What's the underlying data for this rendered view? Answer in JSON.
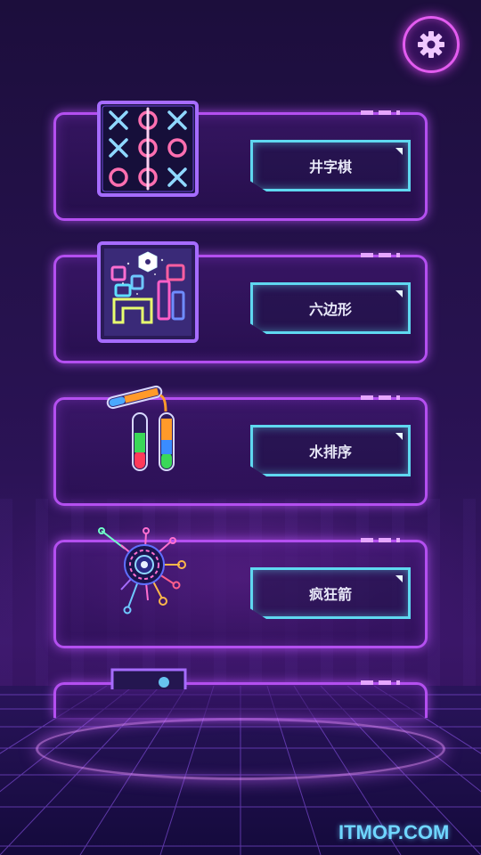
{
  "menu": {
    "games": [
      {
        "label": "井字棋",
        "icon": "tic-tac-toe-icon"
      },
      {
        "label": "六边形",
        "icon": "hexa-blocks-icon"
      },
      {
        "label": "水排序",
        "icon": "water-sort-tubes-icon"
      },
      {
        "label": "疯狂箭",
        "icon": "crazy-arrow-target-icon"
      }
    ]
  },
  "settings": {
    "icon": "gear-icon"
  },
  "watermark": "ITMOP.COM",
  "colors": {
    "card_border": "#b44ff0",
    "label_border": "#5fd8f0",
    "settings_border": "#e35cf0"
  }
}
